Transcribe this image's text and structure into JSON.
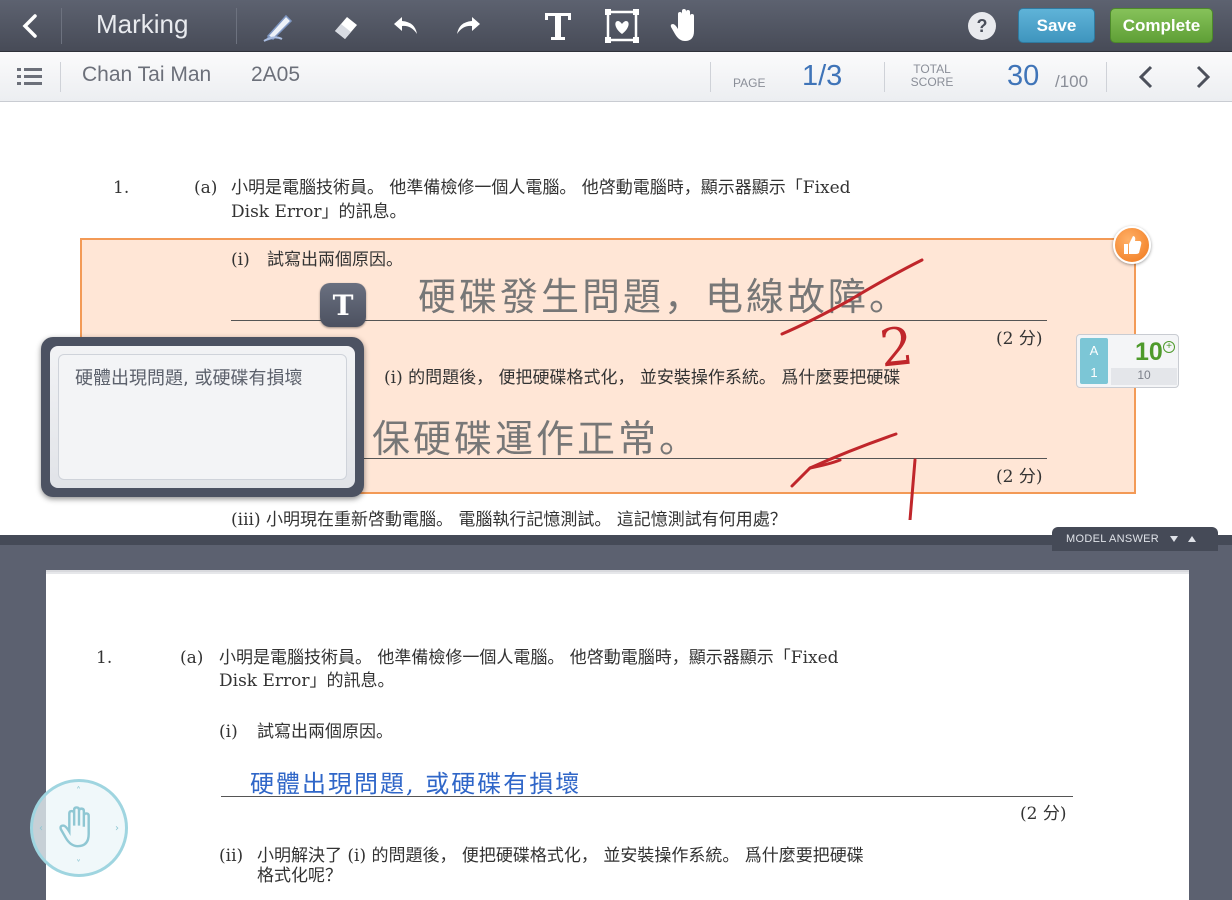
{
  "toolbar": {
    "title": "Marking",
    "save_label": "Save",
    "complete_label": "Complete",
    "help_label": "?"
  },
  "subheader": {
    "student_name": "Chan Tai Man",
    "class": "2A05",
    "page_label": "PAGE",
    "page_value": "1/3",
    "total_label_1": "TOTAL",
    "total_label_2": "SCORE",
    "score_value": "30",
    "score_max": "/100"
  },
  "paper": {
    "q_number": "1.",
    "part_a": "(a)",
    "stem_line1": "小明是電腦技術員。 他準備檢修一個人電腦。 他啓動電腦時，顯示器顯示「Fixed",
    "stem_line2": "Disk Error」的訊息。",
    "q_i_num": "(i)",
    "q_i_text": "試寫出兩個原因。",
    "answer_i": "硬碟發生問題，电線故障。",
    "marks_i": "(2 分)",
    "q_ii_partial": "(i) 的問題後， 便把硬碟格式化， 並安裝操作系統。 爲什麼要把硬碟",
    "answer_ii": "保硬碟運作正常。",
    "marks_ii": "(2 分)",
    "q_iii_text": "(iii) 小明現在重新啓動電腦。 電腦執行記憶測試。 這記憶測試有何用處？",
    "mark_2": "2",
    "mark_1": "1",
    "t_tag": "T"
  },
  "comment": {
    "text": "硬體出現問題, 或硬碟有損壞"
  },
  "score_widget": {
    "a_label": "A",
    "a_num": "1",
    "value": "10",
    "max": "10",
    "plus": "+"
  },
  "model_answer": {
    "tab_label": "MODEL ANSWER",
    "q_number": "1.",
    "part_a": "(a)",
    "stem_line1": "小明是電腦技術員。 他準備檢修一個人電腦。 他啓動電腦時，顯示器顯示「Fixed",
    "stem_line2": "Disk Error」的訊息。",
    "q_i_num": "(i)",
    "q_i_text": "試寫出兩個原因。",
    "answer_i": "硬體出現問題, 或硬碟有損壞",
    "marks_i": "(2 分)",
    "q_ii_num": "(ii)",
    "q_ii_line1": "小明解決了 (i) 的問題後， 便把硬碟格式化， 並安裝操作系統。 爲什麼要把硬碟",
    "q_ii_line2": "格式化呢？"
  }
}
